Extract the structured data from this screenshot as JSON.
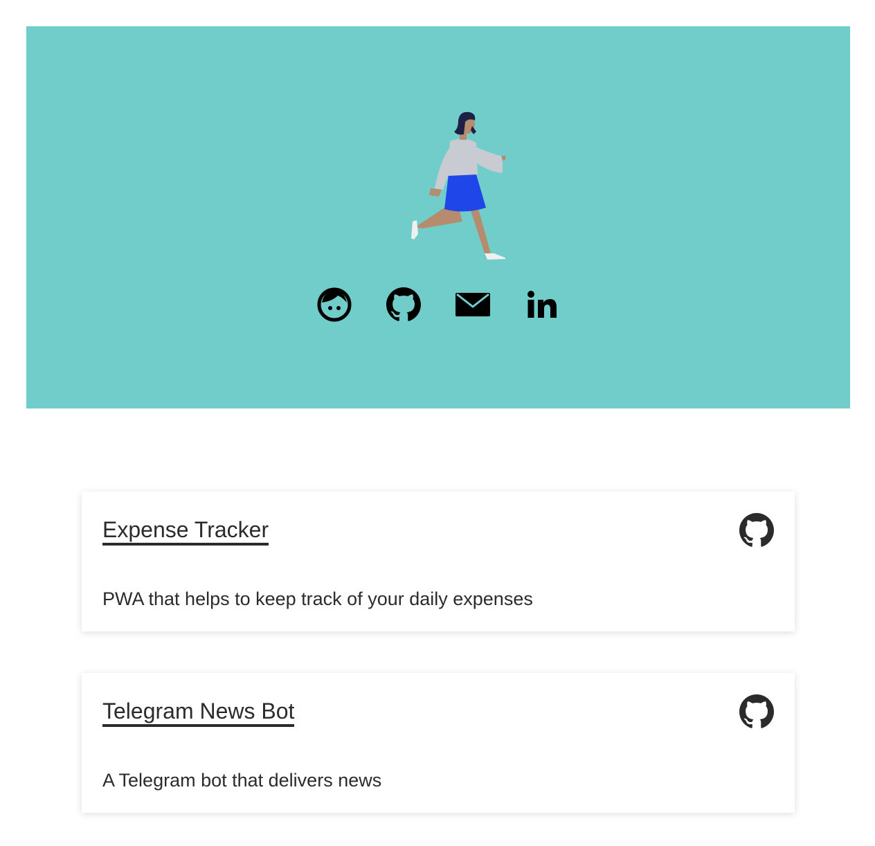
{
  "hero": {
    "background_color": "#70cdca",
    "illustration": "walking-woman-illustration",
    "social_links": [
      {
        "name": "about-face-icon"
      },
      {
        "name": "github-icon"
      },
      {
        "name": "mail-icon"
      },
      {
        "name": "linkedin-icon"
      }
    ]
  },
  "projects": [
    {
      "title": "Expense Tracker",
      "description": "PWA that helps to keep track of your daily expenses",
      "icon": "github-icon"
    },
    {
      "title": "Telegram News Bot",
      "description": "A Telegram bot that delivers news",
      "icon": "github-icon"
    }
  ]
}
